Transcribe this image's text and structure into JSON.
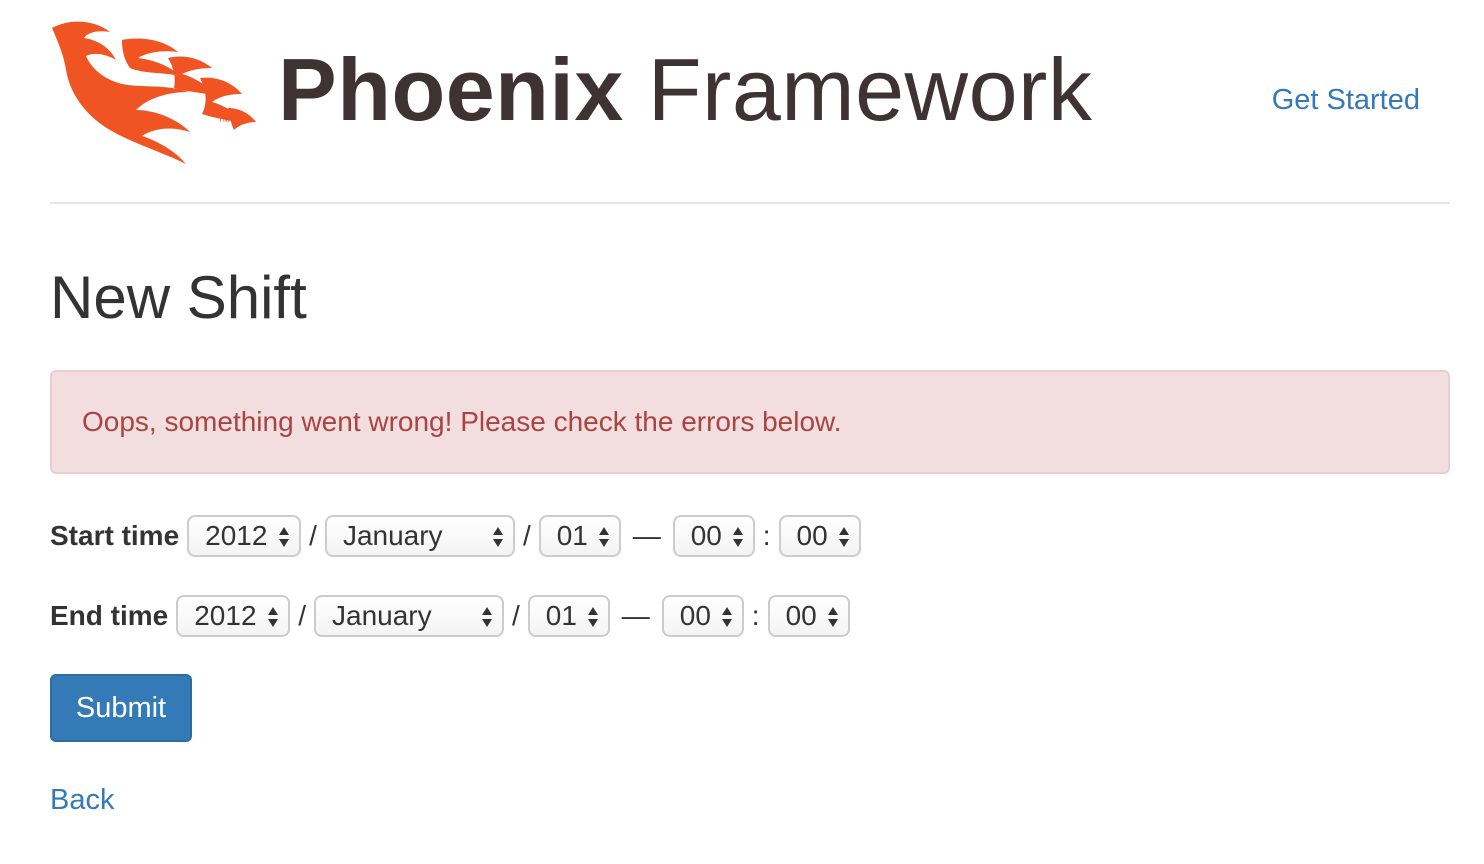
{
  "header": {
    "brand_bold": "Phoenix",
    "brand_light": "Framework",
    "nav_link": "Get Started",
    "logo_color": "#f05423"
  },
  "page_title": "New Shift",
  "alert": {
    "message": "Oops, something went wrong! Please check the errors below.",
    "bg_color": "#f2dede",
    "text_color": "#a94442"
  },
  "form": {
    "start": {
      "label": "Start time",
      "year": "2012",
      "month": "January",
      "day": "01",
      "hour": "00",
      "minute": "00"
    },
    "end": {
      "label": "End time",
      "year": "2012",
      "month": "January",
      "day": "01",
      "hour": "00",
      "minute": "00"
    },
    "separators": {
      "date": "/",
      "dash": "—",
      "time": ":"
    },
    "submit_label": "Submit",
    "back_label": "Back"
  },
  "colors": {
    "link": "#337ab7",
    "primary_button": "#337ab7"
  }
}
